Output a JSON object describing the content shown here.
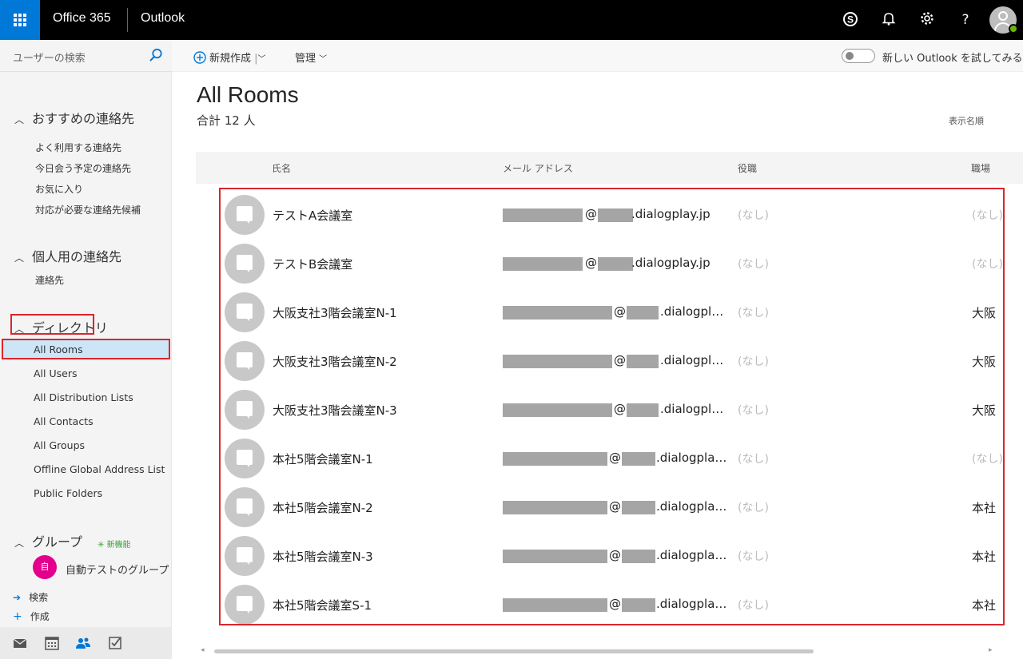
{
  "topbar": {
    "brand": "Office 365",
    "app": "Outlook",
    "icons": [
      "skype-icon",
      "bell-icon",
      "gear-icon",
      "help-icon"
    ],
    "help_glyph": "?"
  },
  "left": {
    "search_placeholder": "ユーザーの検索",
    "sections": [
      {
        "title": "おすすめの連絡先",
        "items": [
          "よく利用する連絡先",
          "今日会う予定の連絡先",
          "お気に入り",
          "対応が必要な連絡先候補"
        ]
      },
      {
        "title": "個人用の連絡先",
        "items": [
          "連絡先"
        ]
      },
      {
        "title": "ディレクトリ",
        "items": [
          "All Rooms",
          "All Users",
          "All Distribution Lists",
          "All Contacts",
          "All Groups",
          "Offline Global Address List",
          "Public Folders"
        ]
      }
    ],
    "groups": {
      "title": "グループ",
      "badge": "新機能",
      "group_name": "自動テストのグループ",
      "group_initial": "自",
      "search": "検索",
      "create": "作成"
    }
  },
  "cmdbar": {
    "new": "新規作成",
    "new_sep": "|",
    "manage": "管理",
    "try_new": "新しい Outlook を試してみる"
  },
  "main": {
    "title": "All Rooms",
    "count": "合計 12 人",
    "sort": "表示名順",
    "columns": {
      "name": "氏名",
      "email": "メール アドレス",
      "role": "役職",
      "workplace": "職場"
    },
    "rows": [
      {
        "name": "テストA会議室",
        "domain": ".dialogplay.jp",
        "role": "(なし)",
        "workplace": "(なし)"
      },
      {
        "name": "テストB会議室",
        "domain": ".dialogplay.jp",
        "role": "(なし)",
        "workplace": "(なし)"
      },
      {
        "name": "大阪支社3階会議室N-1",
        "domain": ".dialogpl…",
        "role": "(なし)",
        "workplace": "大阪"
      },
      {
        "name": "大阪支社3階会議室N-2",
        "domain": ".dialogpl…",
        "role": "(なし)",
        "workplace": "大阪"
      },
      {
        "name": "大阪支社3階会議室N-3",
        "domain": ".dialogpl…",
        "role": "(なし)",
        "workplace": "大阪"
      },
      {
        "name": "本社5階会議室N-1",
        "domain": ".dialogpla…",
        "role": "(なし)",
        "workplace": "(なし)"
      },
      {
        "name": "本社5階会議室N-2",
        "domain": ".dialogpla…",
        "role": "(なし)",
        "workplace": "本社"
      },
      {
        "name": "本社5階会議室N-3",
        "domain": ".dialogpla…",
        "role": "(なし)",
        "workplace": "本社"
      },
      {
        "name": "本社5階会議室S-1",
        "domain": ".dialogpla…",
        "role": "(なし)",
        "workplace": "本社"
      }
    ]
  },
  "accent": {
    "brand_blue": "#0078d7",
    "highlight_red": "#d9262c",
    "selected_bg": "#cde6f7",
    "group_pink": "#e3008c"
  }
}
